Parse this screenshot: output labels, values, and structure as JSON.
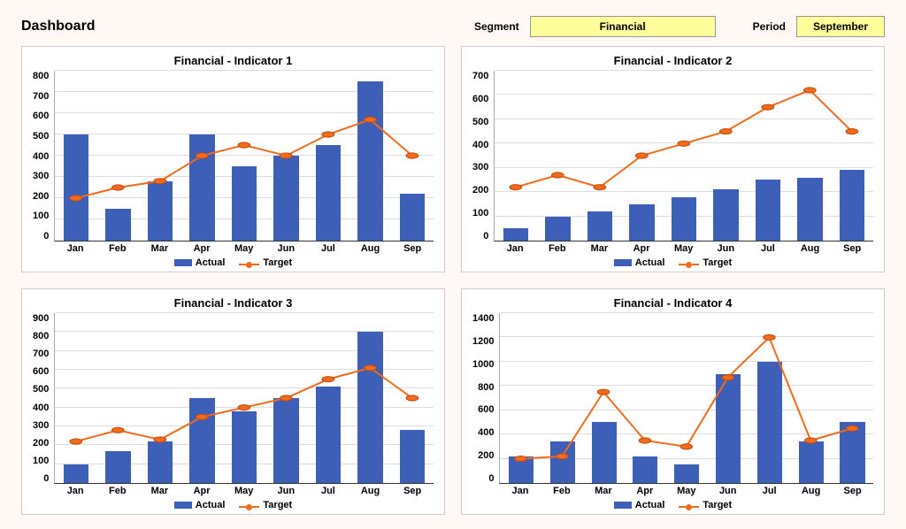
{
  "header": {
    "title": "Dashboard",
    "segment_label": "Segment",
    "segment_value": "Financial",
    "period_label": "Period",
    "period_value": "September"
  },
  "legend": {
    "actual": "Actual",
    "target": "Target"
  },
  "chart_data": [
    {
      "type": "bar",
      "title": "Financial - Indicator 1",
      "categories": [
        "Jan",
        "Feb",
        "Mar",
        "Apr",
        "May",
        "Jun",
        "Jul",
        "Aug",
        "Sep"
      ],
      "series": [
        {
          "name": "Actual",
          "values": [
            500,
            150,
            280,
            500,
            350,
            400,
            450,
            750,
            220
          ]
        },
        {
          "name": "Target",
          "values": [
            200,
            250,
            280,
            400,
            450,
            400,
            500,
            570,
            400
          ]
        }
      ],
      "xlabel": "",
      "ylabel": "",
      "ylim": [
        0,
        800
      ],
      "yticks": [
        0,
        100,
        200,
        300,
        400,
        500,
        600,
        700,
        800
      ]
    },
    {
      "type": "bar",
      "title": "Financial - Indicator 2",
      "categories": [
        "Jan",
        "Feb",
        "Mar",
        "Apr",
        "May",
        "Jun",
        "Jul",
        "Aug",
        "Sep"
      ],
      "series": [
        {
          "name": "Actual",
          "values": [
            50,
            100,
            120,
            150,
            180,
            210,
            250,
            260,
            290
          ]
        },
        {
          "name": "Target",
          "values": [
            220,
            270,
            220,
            350,
            400,
            450,
            550,
            620,
            450
          ]
        }
      ],
      "xlabel": "",
      "ylabel": "",
      "ylim": [
        0,
        700
      ],
      "yticks": [
        0,
        100,
        200,
        300,
        400,
        500,
        600,
        700
      ]
    },
    {
      "type": "bar",
      "title": "Financial - Indicator 3",
      "categories": [
        "Jan",
        "Feb",
        "Mar",
        "Apr",
        "May",
        "Jun",
        "Jul",
        "Aug",
        "Sep"
      ],
      "series": [
        {
          "name": "Actual",
          "values": [
            100,
            170,
            220,
            450,
            380,
            450,
            510,
            800,
            280
          ]
        },
        {
          "name": "Target",
          "values": [
            220,
            280,
            230,
            350,
            400,
            450,
            550,
            610,
            450
          ]
        }
      ],
      "xlabel": "",
      "ylabel": "",
      "ylim": [
        0,
        900
      ],
      "yticks": [
        0,
        100,
        200,
        300,
        400,
        500,
        600,
        700,
        800,
        900
      ]
    },
    {
      "type": "bar",
      "title": "Financial - Indicator 4",
      "categories": [
        "Jan",
        "Feb",
        "Mar",
        "Apr",
        "May",
        "Jun",
        "Jul",
        "Aug",
        "Sep"
      ],
      "series": [
        {
          "name": "Actual",
          "values": [
            220,
            340,
            500,
            220,
            150,
            900,
            1000,
            340,
            500
          ]
        },
        {
          "name": "Target",
          "values": [
            200,
            220,
            750,
            350,
            300,
            870,
            1200,
            350,
            450
          ]
        }
      ],
      "xlabel": "",
      "ylabel": "",
      "ylim": [
        0,
        1400
      ],
      "yticks": [
        0,
        200,
        400,
        600,
        800,
        1000,
        1200,
        1400
      ]
    }
  ]
}
